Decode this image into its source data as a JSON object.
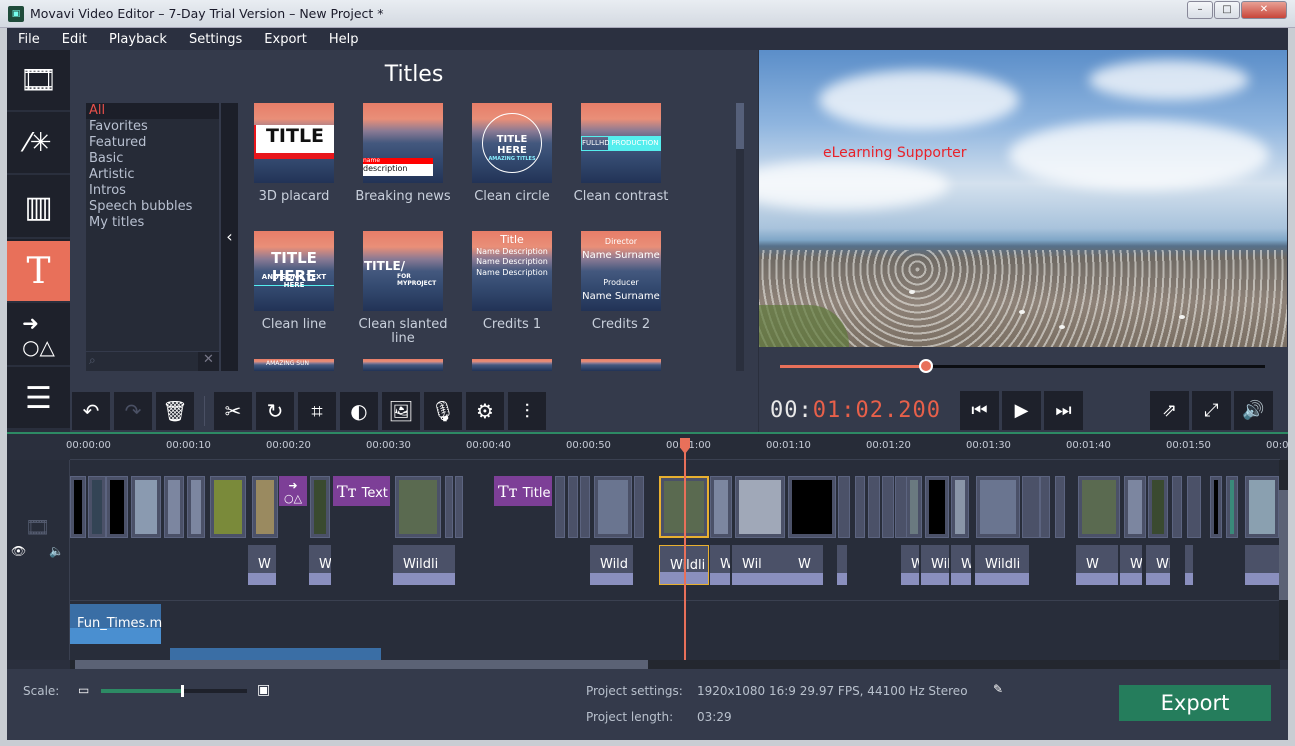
{
  "window": {
    "title": "Movavi Video Editor – 7-Day Trial Version – New Project *",
    "controls": [
      "minimize",
      "maximize",
      "close"
    ]
  },
  "menu": [
    "File",
    "Edit",
    "Playback",
    "Settings",
    "Export",
    "Help"
  ],
  "sidebar": [
    {
      "name": "import-media",
      "icon": "film-play-icon"
    },
    {
      "name": "filters",
      "icon": "magic-wand-icon"
    },
    {
      "name": "transitions",
      "icon": "film-transition-icon"
    },
    {
      "name": "titles",
      "icon": "text-t-icon",
      "active": true
    },
    {
      "name": "stickers",
      "icon": "shapes-arrow-icon"
    },
    {
      "name": "more-tools",
      "icon": "list-icon"
    }
  ],
  "panel": {
    "title": "Titles",
    "categories": [
      "All",
      "Favorites",
      "Featured",
      "Basic",
      "Artistic",
      "Intros",
      "Speech bubbles",
      "My titles"
    ],
    "selected_category": "All",
    "search_placeholder": "",
    "titles": [
      {
        "label": "3D placard",
        "preview": "TITLE"
      },
      {
        "label": "Breaking news",
        "preview": "name",
        "preview2": "description"
      },
      {
        "label": "Clean circle",
        "preview": "TITLE HERE",
        "preview2": "AMAZING TITLES"
      },
      {
        "label": "Clean contrast",
        "preview": "FULLHD",
        "preview2": "PRODUCTION"
      },
      {
        "label": "Clean line",
        "preview": "TITLE HERE",
        "preview2": "AND SOME TEXT HERE"
      },
      {
        "label": "Clean slanted line",
        "preview": "TITLE/",
        "preview2": "FOR MYPROJECT"
      },
      {
        "label": "Credits 1",
        "preview": "Title",
        "preview2": "Name Description"
      },
      {
        "label": "Credits 2",
        "preview": "Director",
        "preview2": "Name Surname",
        "preview3": "Producer"
      },
      {
        "label": "",
        "preview": "AMAZING SUN"
      }
    ]
  },
  "preview": {
    "overlay_text": "eLearning Supporter",
    "overlay_color": "#e8222a",
    "progress": 0.3
  },
  "toolbar": {
    "buttons": [
      "undo",
      "redo",
      "delete",
      "cut",
      "rotate",
      "crop",
      "color-adjust",
      "image",
      "record-voice",
      "settings",
      "equalizer"
    ]
  },
  "player": {
    "timecode_prefix": "00:",
    "timecode_main": "01:02.200",
    "buttons": [
      "previous",
      "play",
      "next",
      "detach-preview",
      "fullscreen",
      "volume"
    ]
  },
  "timeline": {
    "ticks": [
      "00:00:00",
      "00:00:10",
      "00:00:20",
      "00:00:30",
      "00:00:40",
      "00:00:50",
      "00:01:00",
      "00:01:10",
      "00:01:20",
      "00:01:30",
      "00:01:40",
      "00:01:50",
      "00:0"
    ],
    "title_clips": [
      "Text",
      "Title"
    ],
    "audio_labels": [
      "W",
      "W",
      "Wildli",
      "Wild",
      "Wildli",
      "Wildlif",
      "Wil",
      "W",
      "W",
      "Wildli",
      "W",
      "Wildli",
      "W",
      "W",
      "Wil"
    ],
    "music_clip": "Fun_Times.m"
  },
  "bottom": {
    "scale_label": "Scale:",
    "scale_value": 0.55,
    "settings_label": "Project settings:",
    "settings_value": "1920x1080 16:9 29.97 FPS, 44100 Hz Stereo",
    "length_label": "Project length:",
    "length_value": "03:29",
    "export_label": "Export"
  },
  "colors": {
    "accent": "#e8705a",
    "export": "#257d5c",
    "title_clip": "#7d3f97",
    "music": "#3a6ea5"
  }
}
